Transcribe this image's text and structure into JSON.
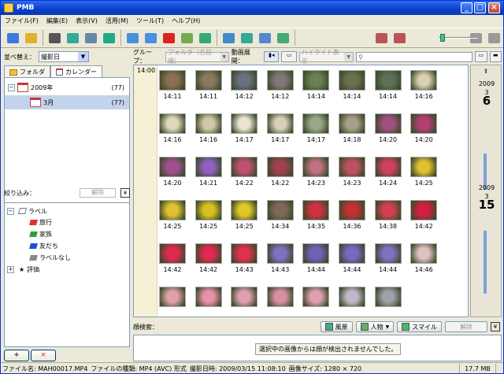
{
  "window": {
    "title": "PMB"
  },
  "menu": [
    "ファイル(F)",
    "編集(E)",
    "表示(V)",
    "活用(M)",
    "ツール(T)",
    "ヘルプ(H)"
  ],
  "toolbar": {
    "icons": [
      "import-icon",
      "folder-open-icon",
      "print-icon",
      "globe-share-icon",
      "email-icon",
      "disc-export-icon",
      "rotate-left-icon",
      "rotate-right-icon",
      "delete-icon",
      "edit-icon",
      "slideshow-icon",
      "map-icon",
      "world-icon",
      "upload-icon",
      "sync-icon",
      "camera-in-icon",
      "camera-out-icon",
      "thumb-small-icon",
      "thumb-large-icon"
    ],
    "zoom_level": 0.2
  },
  "left": {
    "sort_label": "並べ替え：",
    "sort_value": "撮影日",
    "tab_folder": "フォルダ",
    "tab_calendar": "カレンダー",
    "tree": [
      {
        "label": "2009年",
        "count": "(77)"
      },
      {
        "label": "3月",
        "count": "(77)"
      }
    ],
    "filter_label": "絞り込み：",
    "filter_clear": "解除",
    "filter_label_group": "ラベル",
    "labels": [
      {
        "name": "旅行",
        "color": "#e03030"
      },
      {
        "name": "家族",
        "color": "#30a040"
      },
      {
        "name": "友だち",
        "color": "#2050d0"
      },
      {
        "name": "ラベルなし",
        "color": "#888888"
      }
    ],
    "filter_rating": "評価"
  },
  "main": {
    "group_label": "グループ：",
    "group_value": "フォルダ（名前順）",
    "expand_label": "動画展開：",
    "highlight_value": "ハイライト表示",
    "time_header": "14:00",
    "thumbs": [
      [
        "14:11",
        "14:11",
        "14:12",
        "14:12",
        "14:14",
        "14:14",
        "14:14",
        "14:16"
      ],
      [
        "14:16",
        "14:16",
        "14:17",
        "14:17",
        "14:17",
        "14:18",
        "14:20",
        "14:20"
      ],
      [
        "14:20",
        "14:21",
        "14:22",
        "14:22",
        "14:23",
        "14:23",
        "14:24",
        "14:25"
      ],
      [
        "14:25",
        "14:25",
        "14:25",
        "14:34",
        "14:35",
        "14:36",
        "14:38",
        "14:42"
      ],
      [
        "14:42",
        "14:42",
        "14:43",
        "14:43",
        "14:44",
        "14:44",
        "14:44",
        "14:46"
      ],
      [
        "",
        "",
        "",
        "",
        "",
        "",
        "",
        ""
      ]
    ],
    "timeline": [
      {
        "year": "2009",
        "month": "3",
        "day": "6"
      },
      {
        "year": "2009",
        "month": "3",
        "day": "15"
      }
    ],
    "face_label": "顔検索：",
    "face_buttons": [
      "風景",
      "人物",
      "スマイル"
    ],
    "face_clear": "解除",
    "face_message": "選択中の画像からは顔が検出されませんでした。"
  },
  "status": {
    "filename": "ファイル名: MAH00017.MP4",
    "filetype": "ファイルの種類: MP4 (AVC) 形式",
    "date": "撮影日時: 2009/03/15 11:08:10",
    "size": "画像サイズ: 1280 × 720",
    "filesize": "17.7 MB"
  },
  "colors": {
    "accent": "#0a3fc8",
    "selection": "#c4d3ec"
  }
}
